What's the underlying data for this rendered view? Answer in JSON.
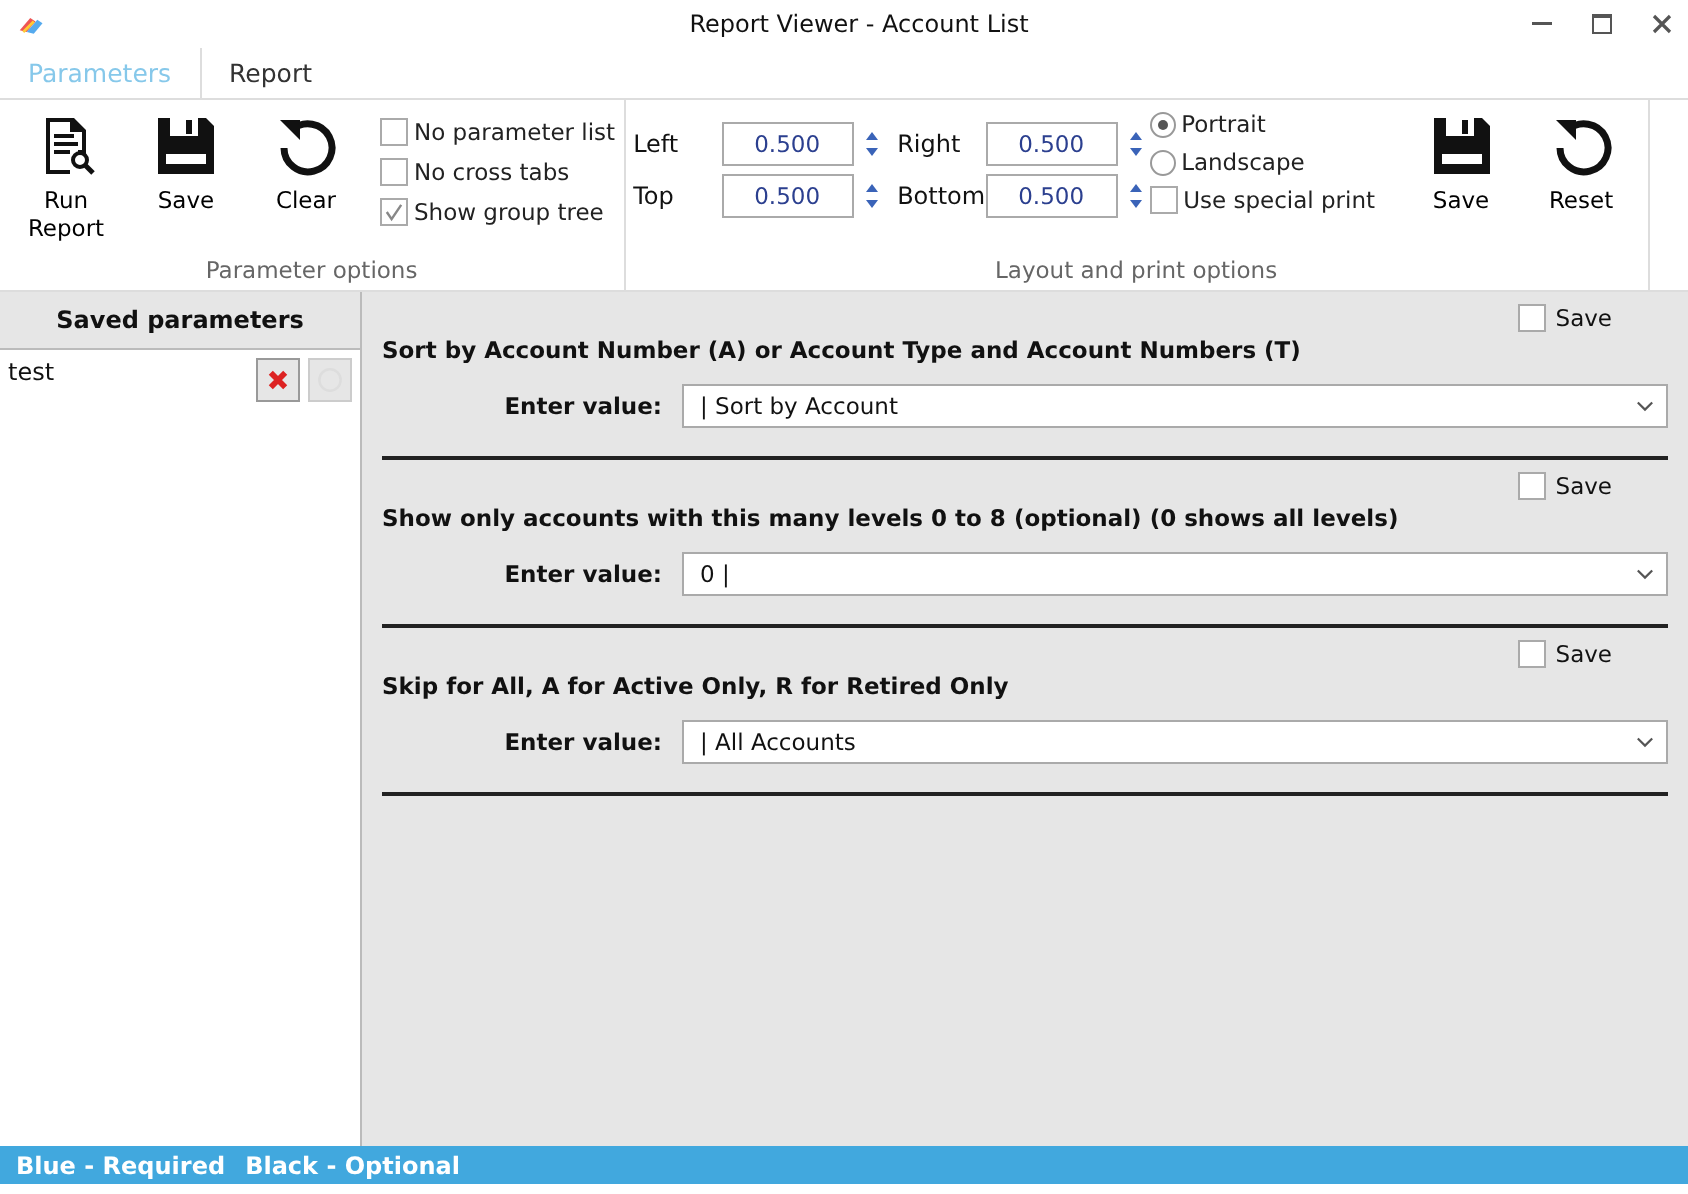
{
  "window": {
    "title": "Report Viewer - Account List"
  },
  "tabs": [
    {
      "label": "Parameters",
      "selected": true
    },
    {
      "label": "Report",
      "selected": false
    }
  ],
  "parameter_options": {
    "label": "Parameter options",
    "buttons": [
      {
        "kind": "report",
        "label": "Run Report"
      },
      {
        "kind": "save",
        "label": "Save"
      },
      {
        "kind": "clear",
        "label": "Clear"
      }
    ],
    "checkboxes": [
      {
        "label": "No parameter list",
        "checked": false
      },
      {
        "label": "No cross tabs",
        "checked": false
      },
      {
        "label": "Show group tree",
        "checked": true
      }
    ]
  },
  "layout_options": {
    "label": "Layout and print options",
    "margins": [
      {
        "label": "Left",
        "value": "0.500"
      },
      {
        "label": "Right",
        "value": "0.500"
      },
      {
        "label": "Top",
        "value": "0.500"
      },
      {
        "label": "Bottom",
        "value": "0.500"
      }
    ],
    "orientations": [
      {
        "label": "Portrait",
        "selected": true
      },
      {
        "label": "Landscape",
        "selected": false
      }
    ],
    "special_print": {
      "label": "Use special print",
      "checked": false
    },
    "buttons": [
      {
        "kind": "save",
        "label": "Save"
      },
      {
        "kind": "reset",
        "label": "Reset"
      }
    ]
  },
  "saved_parameters": {
    "title": "Saved parameters",
    "items": [
      {
        "name": "test"
      }
    ]
  },
  "parameters": [
    {
      "prompt": "Sort by Account Number (A) or Account Type and Account Numbers (T)",
      "save_label": "Save",
      "save": false,
      "value_label": "Enter value:",
      "value": "| Sort by Account"
    },
    {
      "prompt": "Show only accounts with this many levels 0 to 8 (optional) (0 shows all levels)",
      "save_label": "Save",
      "save": false,
      "value_label": "Enter value:",
      "value": "0 |"
    },
    {
      "prompt": "Skip for All, A for Active Only, R for Retired Only",
      "save_label": "Save",
      "save": false,
      "value_label": "Enter value:",
      "value": "| All Accounts"
    }
  ],
  "status_bar": {
    "required": "Blue - Required",
    "optional": "Black - Optional"
  }
}
